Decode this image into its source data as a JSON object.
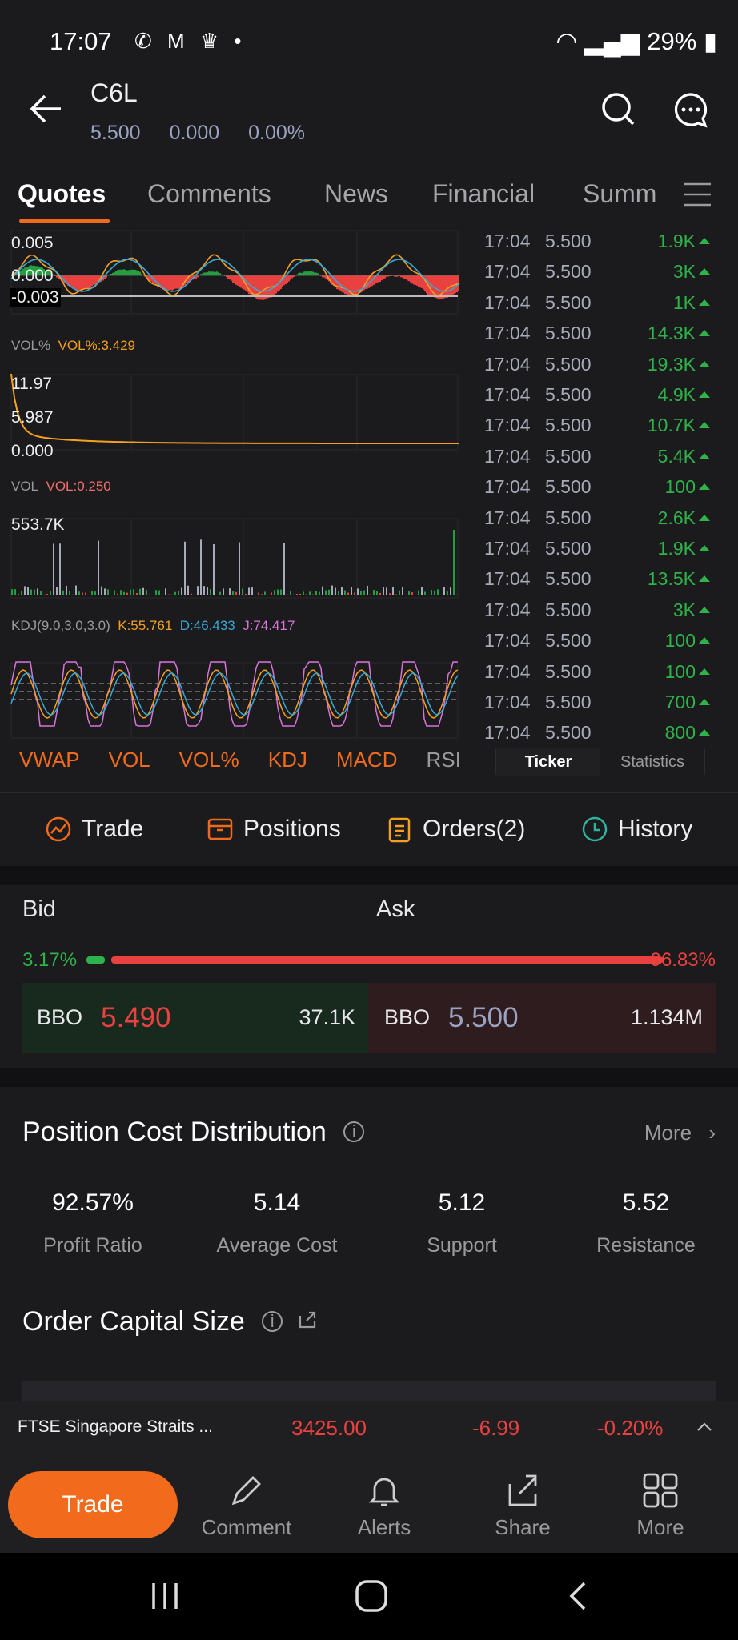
{
  "status_bar": {
    "time": "17:07",
    "battery": "29%"
  },
  "header": {
    "symbol": "C6L",
    "price": "5.500",
    "change": "0.000",
    "change_pct": "0.00%"
  },
  "tabs": [
    {
      "label": "Quotes",
      "active": true
    },
    {
      "label": "Comments"
    },
    {
      "label": "News"
    },
    {
      "label": "Financial"
    },
    {
      "label": "Summ"
    }
  ],
  "macd": {
    "axis": [
      "0.005",
      "0.000",
      "-0.003"
    ]
  },
  "vol_pct": {
    "label": "VOL%",
    "value": "VOL%:3.429",
    "axis": [
      "11.97",
      "5.987",
      "0.000"
    ]
  },
  "vol": {
    "label": "VOL",
    "value": "VOL:0.250",
    "axis": [
      "553.7K"
    ]
  },
  "kdj": {
    "label": "KDJ(9.0,3.0,3.0)",
    "k": "K:55.761",
    "d": "D:46.433",
    "j": "J:74.417"
  },
  "indicator_tabs": [
    "VWAP",
    "VOL",
    "VOL%",
    "KDJ",
    "MACD",
    "RSI"
  ],
  "ticker": {
    "rows": [
      {
        "time": "17:04",
        "price": "5.500",
        "vol": "1.9K"
      },
      {
        "time": "17:04",
        "price": "5.500",
        "vol": "3K"
      },
      {
        "time": "17:04",
        "price": "5.500",
        "vol": "1K"
      },
      {
        "time": "17:04",
        "price": "5.500",
        "vol": "14.3K"
      },
      {
        "time": "17:04",
        "price": "5.500",
        "vol": "19.3K"
      },
      {
        "time": "17:04",
        "price": "5.500",
        "vol": "4.9K"
      },
      {
        "time": "17:04",
        "price": "5.500",
        "vol": "10.7K"
      },
      {
        "time": "17:04",
        "price": "5.500",
        "vol": "5.4K"
      },
      {
        "time": "17:04",
        "price": "5.500",
        "vol": "100"
      },
      {
        "time": "17:04",
        "price": "5.500",
        "vol": "2.6K"
      },
      {
        "time": "17:04",
        "price": "5.500",
        "vol": "1.9K"
      },
      {
        "time": "17:04",
        "price": "5.500",
        "vol": "13.5K"
      },
      {
        "time": "17:04",
        "price": "5.500",
        "vol": "3K"
      },
      {
        "time": "17:04",
        "price": "5.500",
        "vol": "100"
      },
      {
        "time": "17:04",
        "price": "5.500",
        "vol": "100"
      },
      {
        "time": "17:04",
        "price": "5.500",
        "vol": "700"
      },
      {
        "time": "17:04",
        "price": "5.500",
        "vol": "800"
      }
    ],
    "tab_ticker": "Ticker",
    "tab_statistics": "Statistics"
  },
  "actions": {
    "trade": "Trade",
    "positions": "Positions",
    "orders": "Orders(2)",
    "history": "History"
  },
  "bidask": {
    "bid_label": "Bid",
    "ask_label": "Ask",
    "bid_pct": "3.17%",
    "ask_pct": "96.83%",
    "bid_fraction": 0.0317,
    "bid_bbo_label": "BBO",
    "bid_price": "5.490",
    "bid_size": "37.1K",
    "ask_bbo_label": "BBO",
    "ask_price": "5.500",
    "ask_size": "1.134M"
  },
  "position_cost": {
    "title": "Position Cost Distribution",
    "more": "More",
    "stats": [
      {
        "value": "92.57%",
        "label": "Profit Ratio"
      },
      {
        "value": "5.14",
        "label": "Average Cost"
      },
      {
        "value": "5.12",
        "label": "Support"
      },
      {
        "value": "5.52",
        "label": "Resistance"
      }
    ]
  },
  "order_capital": {
    "title": "Order Capital Size"
  },
  "index": {
    "name": "FTSE Singapore Straits ...",
    "value": "3425.00",
    "change": "-6.99",
    "change_pct": "-0.20%"
  },
  "bottom_nav": {
    "trade": "Trade",
    "comment": "Comment",
    "alerts": "Alerts",
    "share": "Share",
    "more": "More"
  },
  "colors": {
    "accent": "#f26b1d",
    "up": "#2fb24a",
    "down": "#e8413f",
    "neutral_price": "#9aa3c2"
  }
}
